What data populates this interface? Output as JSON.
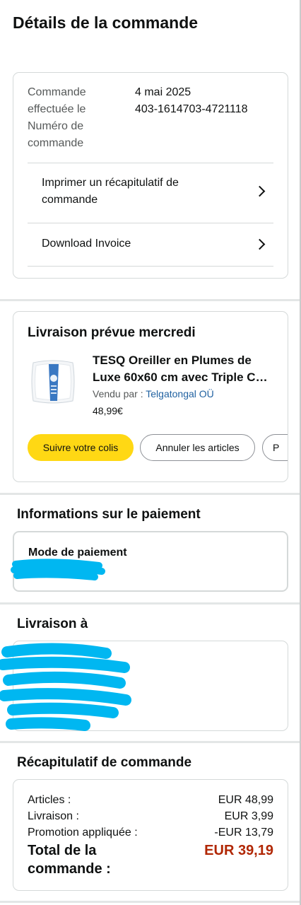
{
  "page": {
    "title": "Détails de la commande"
  },
  "order": {
    "date_label": "Commande effectuée le",
    "date_value": "4 mai 2025",
    "number_label": "Numéro de commande",
    "number_value": "403-1614703-4721118",
    "links": [
      {
        "label": "Imprimer un récapitulatif de commande",
        "icon": "chevron-right-icon"
      },
      {
        "label": "Download Invoice",
        "icon": "chevron-right-icon"
      }
    ]
  },
  "delivery": {
    "title": "Livraison prévue mercredi",
    "product": {
      "name_line1": "TESQ Oreiller en Plumes de",
      "name_line2": "Luxe 60x60 cm avec Triple C…",
      "seller_prefix": "Vendu par  :",
      "seller_name": "Telgatongal OÜ",
      "price": "48,99€",
      "image": "pillow-product-image"
    },
    "buttons": {
      "track": "Suivre votre colis",
      "cancel": "Annuler les articles",
      "more": "P"
    }
  },
  "payment": {
    "section_title": "Informations sur le paiement",
    "method_label": "Mode de paiement"
  },
  "shipping": {
    "section_title": "Livraison à"
  },
  "summary": {
    "section_title": "Récapitulatif de commande",
    "rows": [
      {
        "label": "Articles :",
        "value": "EUR 48,99"
      },
      {
        "label": "Livraison :",
        "value": "EUR 3,99"
      },
      {
        "label": "Promotion appliquée :",
        "value": "-EUR 13,79"
      }
    ],
    "total_label": "Total de la commande :",
    "total_value": "EUR 39,19"
  },
  "colors": {
    "accent_button": "#ffd814",
    "link": "#2162a1",
    "total_price": "#b12704",
    "redaction": "#00b7f1"
  }
}
